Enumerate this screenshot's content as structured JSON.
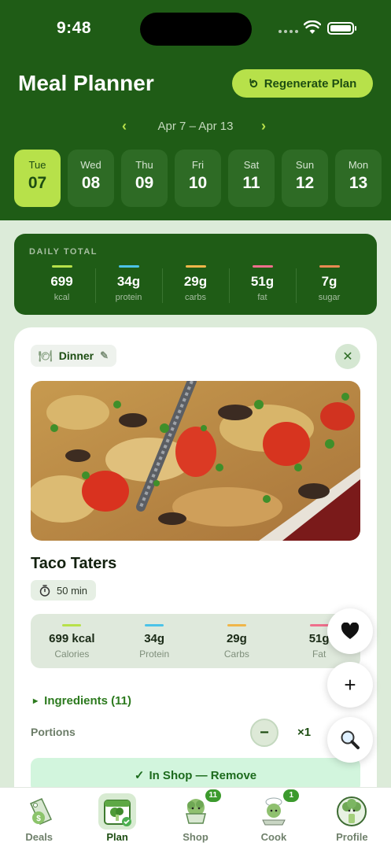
{
  "status_bar": {
    "time": "9:48"
  },
  "header": {
    "title": "Meal Planner",
    "regenerate_label": "Regenerate Plan",
    "week_range": "Apr 7 – Apr 13",
    "prev_icon": "chevron-left-icon",
    "next_icon": "chevron-right-icon"
  },
  "days": [
    {
      "name": "Tue",
      "date": "07",
      "active": true
    },
    {
      "name": "Wed",
      "date": "08"
    },
    {
      "name": "Thu",
      "date": "09"
    },
    {
      "name": "Fri",
      "date": "10"
    },
    {
      "name": "Sat",
      "date": "11"
    },
    {
      "name": "Sun",
      "date": "12"
    },
    {
      "name": "Mon",
      "date": "13"
    }
  ],
  "daily_total": {
    "label": "DAILY TOTAL",
    "items": [
      {
        "value": "699",
        "unit": "kcal",
        "color": "#b7e14a"
      },
      {
        "value": "34g",
        "unit": "protein",
        "color": "#4cc3e8"
      },
      {
        "value": "29g",
        "unit": "carbs",
        "color": "#f0b64a"
      },
      {
        "value": "51g",
        "unit": "fat",
        "color": "#ef6f8c"
      },
      {
        "value": "7g",
        "unit": "sugar",
        "color": "#e88a52"
      }
    ]
  },
  "meal": {
    "type": "Dinner",
    "type_icon": "fork-knife-icon",
    "edit_icon": "pencil-icon",
    "title": "Taco Taters",
    "time": "50 min",
    "time_icon": "stopwatch-icon",
    "macros": [
      {
        "value": "699 kcal",
        "label": "Calories",
        "color": "#b7e14a"
      },
      {
        "value": "34g",
        "label": "Protein",
        "color": "#4cc3e8"
      },
      {
        "value": "29g",
        "label": "Carbs",
        "color": "#f0b64a"
      },
      {
        "value": "51g",
        "label": "Fat",
        "color": "#ef6f8c"
      }
    ],
    "ingredients_label": "Ingredients (11)",
    "portions_label": "Portions",
    "portions_value": "×1",
    "shop_label": "In Shop — Remove"
  },
  "fabs": [
    "heart-icon",
    "plus-icon",
    "magnifier-icon"
  ],
  "tabs": [
    {
      "label": "Deals",
      "badge": ""
    },
    {
      "label": "Plan",
      "badge": "",
      "active": true
    },
    {
      "label": "Shop",
      "badge": "11"
    },
    {
      "label": "Cook",
      "badge": "1"
    },
    {
      "label": "Profile",
      "badge": ""
    }
  ],
  "colors": {
    "header": "#1f5c16",
    "accent": "#b7e14a",
    "background": "#dcebd9"
  }
}
